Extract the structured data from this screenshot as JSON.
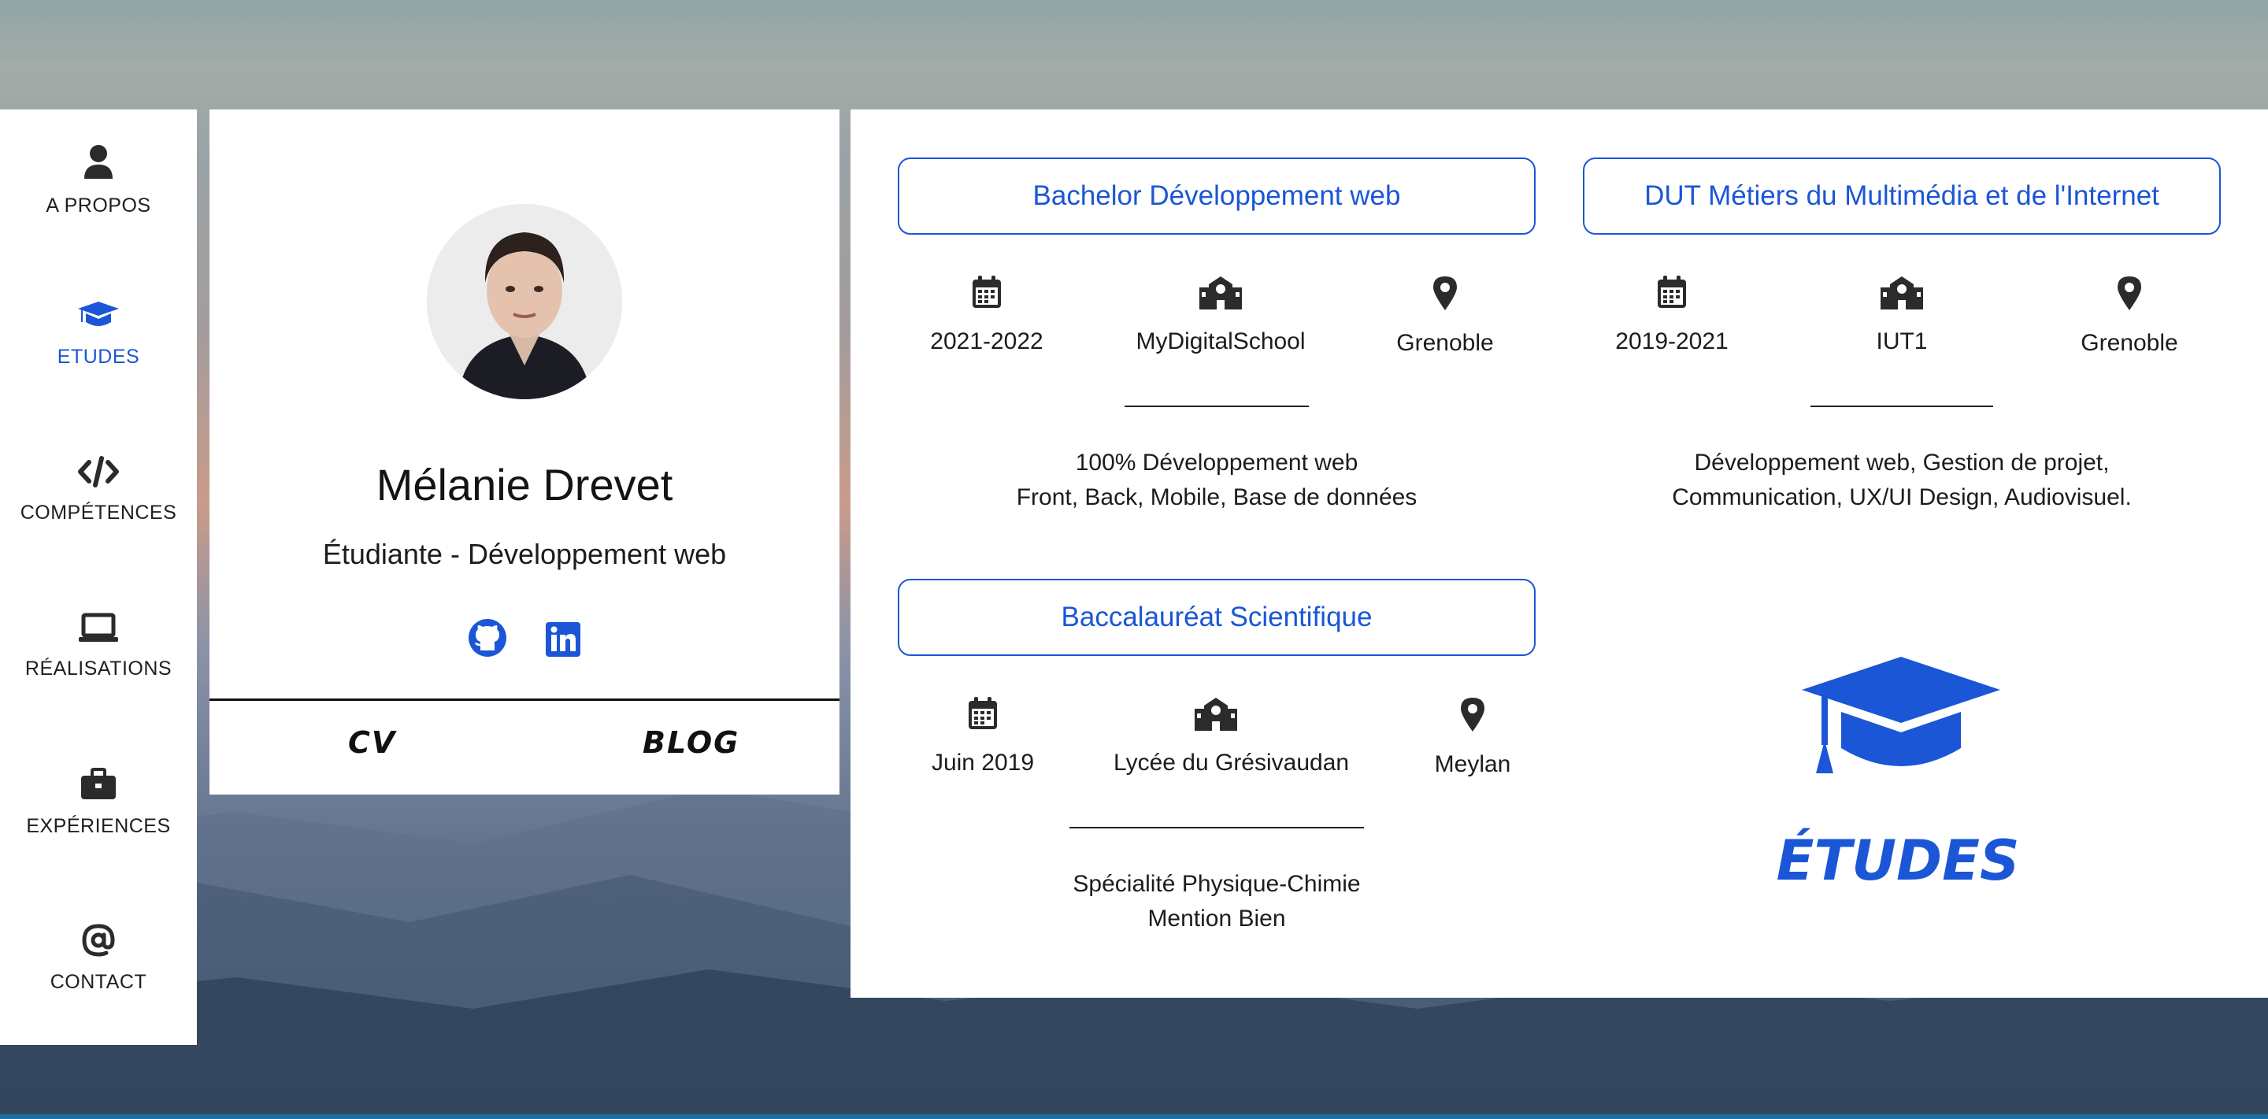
{
  "nav": {
    "items": [
      {
        "label": "A PROPOS",
        "icon": "user-icon"
      },
      {
        "label": "ETUDES",
        "icon": "graduation-cap-icon",
        "active": true
      },
      {
        "label": "COMPÉTENCES",
        "icon": "code-icon"
      },
      {
        "label": "RÉALISATIONS",
        "icon": "laptop-icon"
      },
      {
        "label": "EXPÉRIENCES",
        "icon": "briefcase-icon"
      },
      {
        "label": "CONTACT",
        "icon": "at-icon"
      }
    ]
  },
  "profile": {
    "name": "Mélanie Drevet",
    "subtitle": "Étudiante - Développement web",
    "socials": [
      "github-icon",
      "linkedin-icon"
    ],
    "links": {
      "cv": "CV",
      "blog": "BLOG"
    }
  },
  "education": [
    {
      "title": "Bachelor Développement web",
      "years": "2021-2022",
      "school": "MyDigitalSchool",
      "city": "Grenoble",
      "desc": [
        "100% Développement web",
        "Front, Back, Mobile, Base de données"
      ]
    },
    {
      "title": "DUT Métiers du Multimédia et de l'Internet",
      "years": "2019-2021",
      "school": "IUT1",
      "city": "Grenoble",
      "desc": [
        "Développement web, Gestion de projet,",
        "Communication, UX/UI Design, Audiovisuel."
      ]
    },
    {
      "title": "Baccalauréat Scientifique",
      "years": "Juin 2019",
      "school": "Lycée du Grésivaudan",
      "city": "Meylan",
      "desc": [
        "Spécialité Physique-Chimie",
        "Mention Bien"
      ]
    }
  ],
  "section": {
    "label": "ÉTUDES",
    "icon": "graduation-cap-icon"
  },
  "colors": {
    "accent": "#1a56d6",
    "text": "#1c1c1c",
    "panel": "#ffffff"
  }
}
